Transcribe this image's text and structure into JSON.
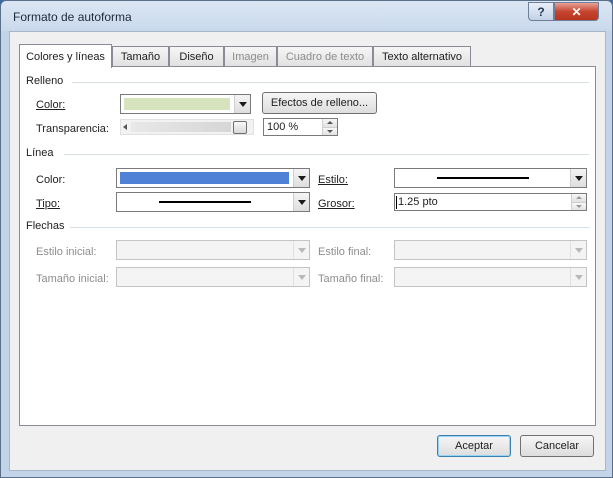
{
  "window": {
    "title": "Formato de autoforma",
    "help_glyph": "?",
    "close_glyph": "✕"
  },
  "tabs": [
    {
      "label": "Colores y líneas",
      "state": "active"
    },
    {
      "label": "Tamaño",
      "state": "normal"
    },
    {
      "label": "Diseño",
      "state": "normal"
    },
    {
      "label": "Imagen",
      "state": "disabled"
    },
    {
      "label": "Cuadro de texto",
      "state": "disabled"
    },
    {
      "label": "Texto alternativo",
      "state": "normal"
    }
  ],
  "fill": {
    "group_label": "Relleno",
    "color_label": "Color:",
    "color_value": "#d6e3bc",
    "effects_button": "Efectos de relleno...",
    "transparency_label": "Transparencia:",
    "transparency_value": "100 %"
  },
  "line": {
    "group_label": "Línea",
    "color_label": "Color:",
    "color_value": "#4f81d6",
    "type_label": "Tipo:",
    "style_label": "Estilo:",
    "weight_label": "Grosor:",
    "weight_value": "1.25 pto"
  },
  "arrows": {
    "group_label": "Flechas",
    "begin_style_label": "Estilo inicial:",
    "begin_size_label": "Tamaño inicial:",
    "end_style_label": "Estilo final:",
    "end_size_label": "Tamaño final:"
  },
  "buttons": {
    "ok": "Aceptar",
    "cancel": "Cancelar"
  }
}
